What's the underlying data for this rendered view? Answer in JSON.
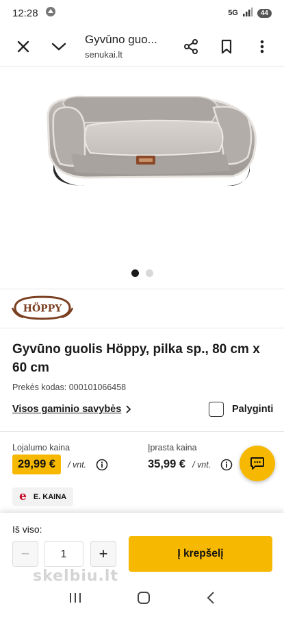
{
  "status": {
    "time": "12:28",
    "network": "5G",
    "battery": "44"
  },
  "toolbar": {
    "title": "Gyvūno guo...",
    "url": "senukai.lt"
  },
  "gallery": {
    "slide_count": 2,
    "active_slide": 1
  },
  "brand": {
    "logo_text": "HÖPPY"
  },
  "product": {
    "title": "Gyvūno guolis Höppy, pilka sp., 80 cm x 60 cm",
    "code_label": "Prekės kodas:",
    "code_value": "000101066458",
    "all_properties_link": "Visos gaminio savybės",
    "compare_label": "Palyginti"
  },
  "pricing": {
    "loyalty_label": "Lojalumo kaina",
    "loyalty_price": "29,99 €",
    "loyalty_unit": "/ vnt.",
    "regular_label": "Įprasta kaina",
    "regular_price": "35,99 €",
    "regular_unit": "/ vnt.",
    "eprice_label": "E. KAINA",
    "eprice_icon": "e"
  },
  "purchase": {
    "quantity_label": "Iš viso:",
    "quantity_value": "1",
    "minus_label": "−",
    "plus_label": "+",
    "add_to_cart_label": "Į krepšelį"
  },
  "watermark": {
    "text": "skelbiu.lt"
  },
  "colors": {
    "accent": "#f6b800",
    "eprice_red": "#c8102e"
  }
}
